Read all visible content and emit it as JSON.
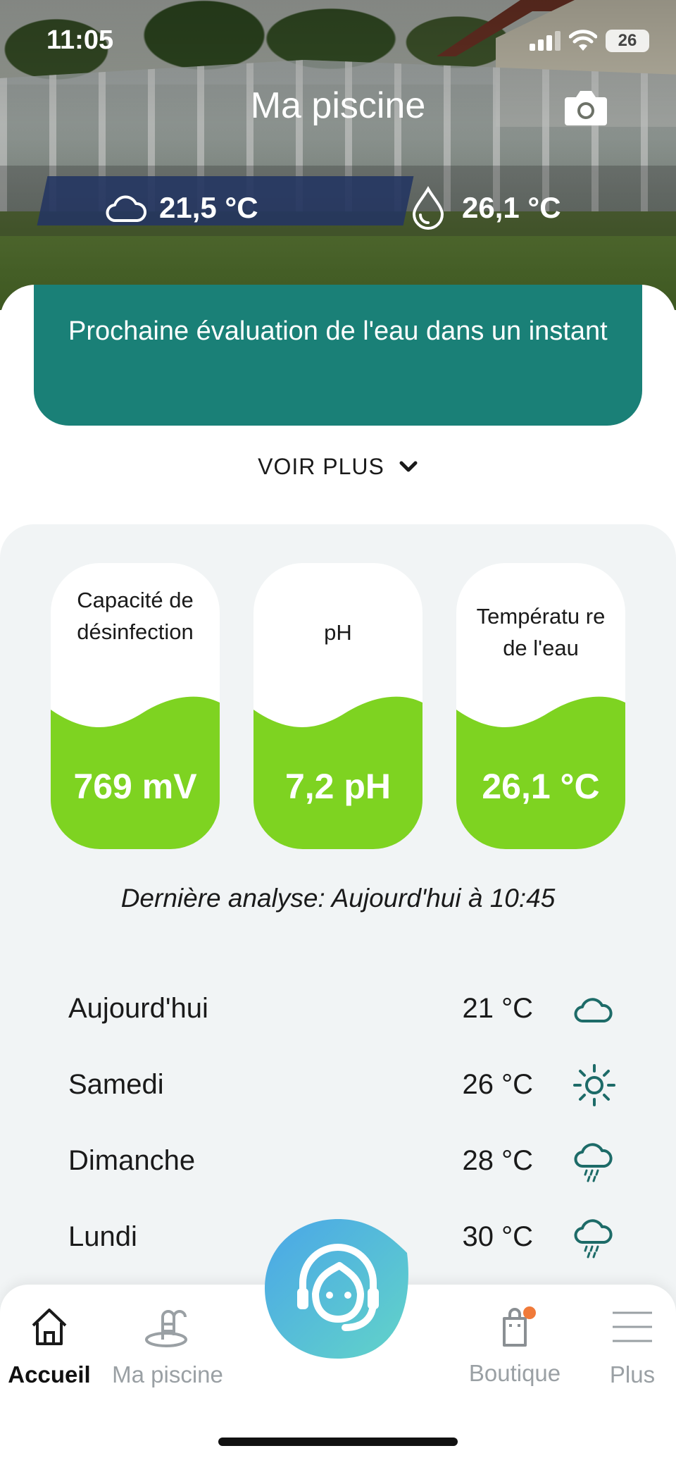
{
  "status_bar": {
    "time": "11:05",
    "battery": "26"
  },
  "header": {
    "title": "Ma piscine",
    "air_temperature": "21,5 °C",
    "water_temperature": "26,1 °C"
  },
  "alert": {
    "message": "Prochaine évaluation de l'eau dans un instant"
  },
  "voir_plus_label": "VOIR PLUS",
  "metrics": [
    {
      "label": "Capacité de désinfection",
      "value": "769 mV"
    },
    {
      "label": "pH",
      "value": "7,2 pH"
    },
    {
      "label": "Températu re de l'eau",
      "value": "26,1 °C"
    }
  ],
  "last_analysis": "Dernière analyse: Aujourd'hui à 10:45",
  "forecast": [
    {
      "day": "Aujourd'hui",
      "temp": "21 °C",
      "icon": "cloud-icon"
    },
    {
      "day": "Samedi",
      "temp": "26 °C",
      "icon": "sun-icon"
    },
    {
      "day": "Dimanche",
      "temp": "28 °C",
      "icon": "rain-cloud-icon"
    },
    {
      "day": "Lundi",
      "temp": "30 °C",
      "icon": "rain-cloud-icon"
    }
  ],
  "tabs": {
    "accueil": "Accueil",
    "ma_piscine": "Ma piscine",
    "boutique": "Boutique",
    "plus": "Plus"
  },
  "colors": {
    "teal": "#1a8077",
    "green": "#7ed321",
    "panel": "#f1f4f5",
    "icon_teal": "#1d6b68",
    "badge": "#f07a3a"
  }
}
